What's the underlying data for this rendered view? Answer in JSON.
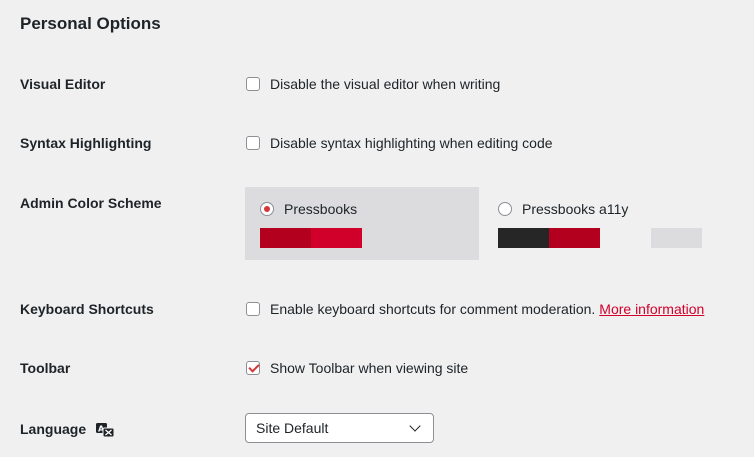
{
  "section_title": "Personal Options",
  "visual_editor": {
    "label": "Visual Editor",
    "checkbox_text": "Disable the visual editor when writing",
    "checked": false
  },
  "syntax": {
    "label": "Syntax Highlighting",
    "checkbox_text": "Disable syntax highlighting when editing code",
    "checked": false
  },
  "color_scheme": {
    "label": "Admin Color Scheme",
    "options": [
      {
        "name": "Pressbooks",
        "selected": true,
        "swatches": [
          "#b4001f",
          "#d1002b",
          "#dcdcde",
          "#dcdcde"
        ]
      },
      {
        "name": "Pressbooks a11y",
        "selected": false,
        "swatches": [
          "#262626",
          "#b4001f",
          "#f0f0f1",
          "#dcdcde"
        ]
      }
    ]
  },
  "keyboard": {
    "label": "Keyboard Shortcuts",
    "checkbox_text": "Enable keyboard shortcuts for comment moderation.",
    "link_text": "More information",
    "checked": false
  },
  "toolbar": {
    "label": "Toolbar",
    "checkbox_text": "Show Toolbar when viewing site",
    "checked": true
  },
  "language": {
    "label": "Language",
    "icon": "translation-icon",
    "select_value": "Site Default"
  }
}
